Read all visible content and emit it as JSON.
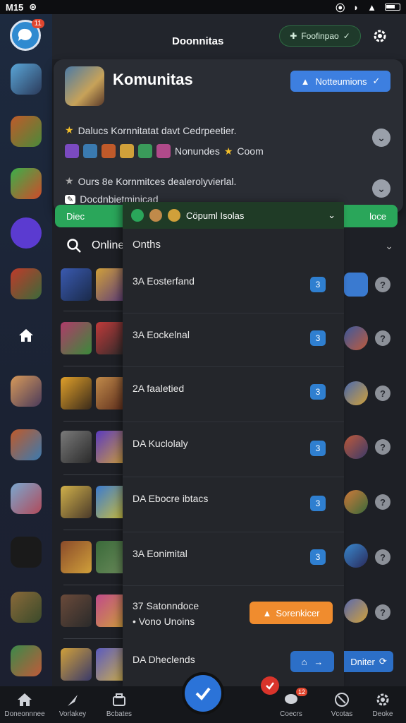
{
  "status": {
    "time": "M15"
  },
  "rail": {
    "top_badge": "11"
  },
  "header": {
    "title": "Doonnitas",
    "chip_label": "Foofinpao",
    "card_title": "Komunitas",
    "notif_label": "Notteumions",
    "line1": "Dalucs Kornnitatat davt Cedrpeetier.",
    "line2_text": "Nonundes",
    "line2_tail": "Coom",
    "line3": "Ours 8e Kornmitces dealerolyvierlal.",
    "line4": "Docdnbietminicad"
  },
  "greenbar": {
    "left": "Diec",
    "right": "loce"
  },
  "search": {
    "label": "Online"
  },
  "dropdown": {
    "head": "Cöpuml Isolas",
    "subtitle": "Onths",
    "items": [
      {
        "label": "3A Eosterfand",
        "count": "3"
      },
      {
        "label": "3A Eockelnal",
        "count": "3"
      },
      {
        "label": "2A faaletied",
        "count": "3"
      },
      {
        "label": "DA Kuclolaly",
        "count": "3"
      },
      {
        "label": "DA Ebocre ibtacs",
        "count": "3"
      },
      {
        "label": "3A Eonimital",
        "count": "3"
      },
      {
        "label": "37 Satonndoce",
        "sub": "Vono Unoins"
      },
      {
        "label": "DA Dheclends"
      }
    ],
    "orange_label": "Sorenkicer",
    "right_chip": "Dniter"
  },
  "bottom_nav": [
    {
      "label": "Doneonnnee"
    },
    {
      "label": "Vorlakey"
    },
    {
      "label": "Bcbates"
    },
    {
      "label": "Coecrs"
    },
    {
      "label": "Vcotas"
    },
    {
      "label": "Deoke"
    }
  ],
  "bottom_badge": "12",
  "colors": {
    "accent_blue": "#3d7fe0",
    "accent_green": "#2aa65a",
    "accent_orange": "#f08c2e",
    "badge_red": "#e0462f"
  }
}
